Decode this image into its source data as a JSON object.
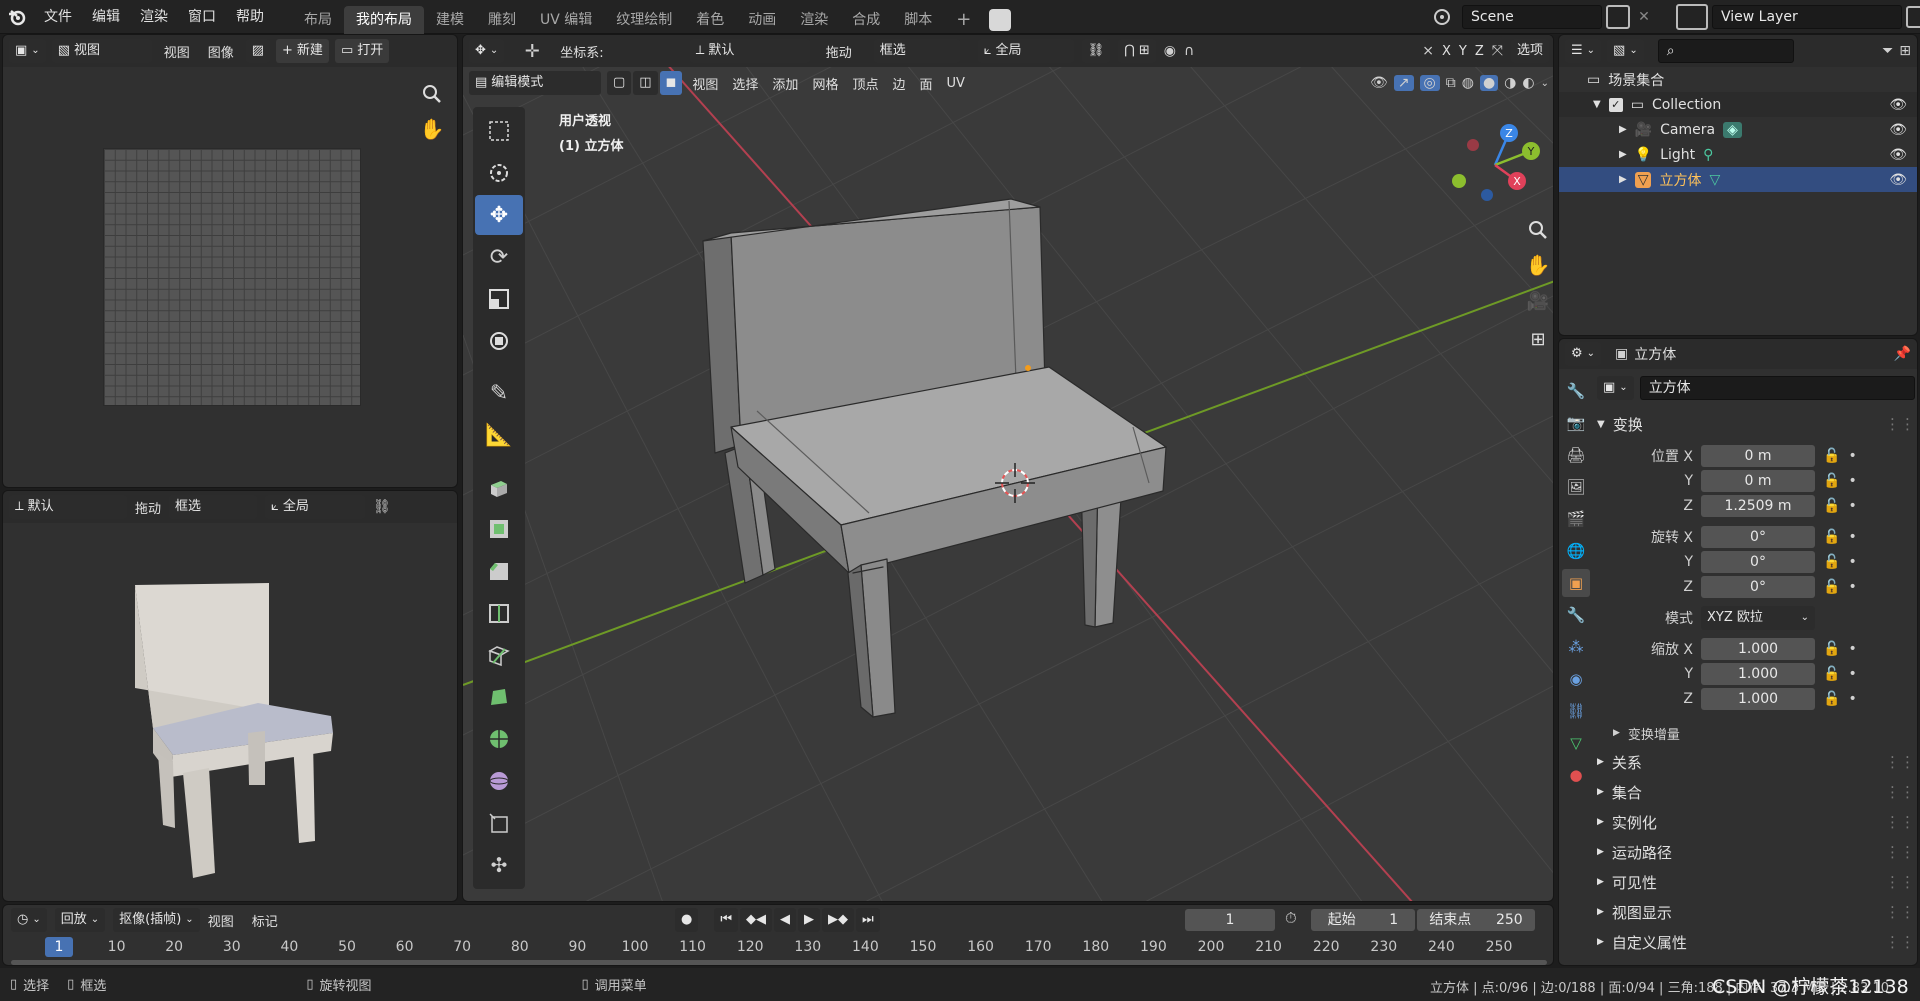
{
  "menu": [
    "文件",
    "编辑",
    "渲染",
    "窗口",
    "帮助"
  ],
  "workspaces": [
    {
      "label": "布局",
      "active": false
    },
    {
      "label": "我的布局",
      "active": true
    },
    {
      "label": "建模",
      "active": false
    },
    {
      "label": "雕刻",
      "active": false
    },
    {
      "label": "UV 编辑",
      "active": false
    },
    {
      "label": "纹理绘制",
      "active": false
    },
    {
      "label": "着色",
      "active": false
    },
    {
      "label": "动画",
      "active": false
    },
    {
      "label": "渲染",
      "active": false
    },
    {
      "label": "合成",
      "active": false
    },
    {
      "label": "脚本",
      "active": false
    }
  ],
  "scene": {
    "name": "Scene"
  },
  "view_layer": {
    "name": "View Layer"
  },
  "image_editor": {
    "view": "视图",
    "menu_view": "视图",
    "menu_image": "图像",
    "new": "新建",
    "open": "打开"
  },
  "preview_header": {
    "orientation": "默认",
    "drag": "拖动",
    "select": "框选",
    "pivot": "全局"
  },
  "viewport_header": {
    "coord_label": "坐标系:",
    "coord_value": "默认",
    "drag": "拖动",
    "select": "框选",
    "pivot": "全局",
    "options": "选项",
    "mode": "编辑模式",
    "menus": [
      "视图",
      "选择",
      "添加",
      "网格",
      "顶点",
      "边",
      "面",
      "UV"
    ],
    "axes": [
      "X",
      "Y",
      "Z"
    ]
  },
  "viewport_info": {
    "line1": "用户透视",
    "line2": "(1) 立方体"
  },
  "outliner": {
    "root": "场景集合",
    "collection": "Collection",
    "items": [
      {
        "name": "Camera",
        "selected": false
      },
      {
        "name": "Light",
        "selected": false
      },
      {
        "name": "立方体",
        "selected": true
      }
    ]
  },
  "properties": {
    "object_name": "立方体",
    "object_field": "立方体",
    "transform_title": "变换",
    "location_label": "位置 X",
    "loc": [
      "0 m",
      "0 m",
      "1.2509 m"
    ],
    "rotation_label": "旋转 X",
    "rot": [
      "0°",
      "0°",
      "0°"
    ],
    "mode_label": "模式",
    "mode_value": "XYZ 欧拉",
    "scale_label": "缩放 X",
    "scale": [
      "1.000",
      "1.000",
      "1.000"
    ],
    "axis_y": "Y",
    "axis_z": "Z",
    "delta": "变换增量",
    "sections": [
      "关系",
      "集合",
      "实例化",
      "运动路径",
      "可见性",
      "视图显示",
      "自定义属性"
    ]
  },
  "timeline": {
    "menus": [
      "回放",
      "抠像(插帧)",
      "视图",
      "标记"
    ],
    "current_frame": "1",
    "start_label": "起始",
    "start": "1",
    "end_label": "结束点",
    "end": "250",
    "ticks": [
      "1",
      "10",
      "20",
      "30",
      "40",
      "50",
      "60",
      "70",
      "80",
      "90",
      "100",
      "110",
      "120",
      "130",
      "140",
      "150",
      "160",
      "170",
      "180",
      "190",
      "200",
      "210",
      "220",
      "230",
      "240",
      "250"
    ]
  },
  "status": {
    "select": "选择",
    "box": "框选",
    "rotate": "旋转视图",
    "menu": "调用菜单",
    "right": "立方体 | 点:0/96 | 边:0/188 | 面:0/94 | 三角:188 | 内存: 37.3 MiB | 2.83.10",
    "watermark": "CSDN @柠檬茶12138"
  },
  "colors": {
    "accent": "#4772b3",
    "selected_row": "#334d80",
    "x_axis": "#e0415a",
    "y_axis": "#8cbe2e",
    "z_axis": "#3a86e6"
  }
}
